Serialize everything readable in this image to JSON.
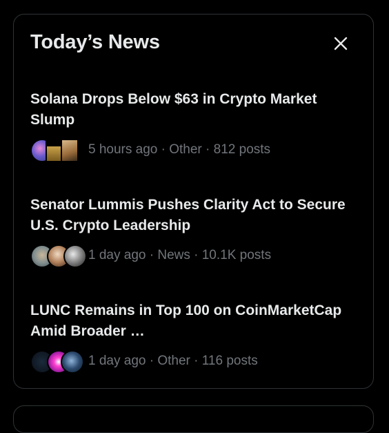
{
  "header": {
    "title": "Today’s News",
    "close_icon": "close-icon"
  },
  "items": [
    {
      "headline": "Solana Drops Below $63 in Crypto Market Slump",
      "meta": "5 hours ago · Other · 812 posts"
    },
    {
      "headline": "Senator Lummis Pushes Clarity Act to Secure U.S. Crypto Leadership",
      "meta": "1 day ago · News · 10.1K posts"
    },
    {
      "headline": "LUNC Remains in Top 100 on CoinMarketCap Amid Broader …",
      "meta": "1 day ago · Other · 116 posts"
    }
  ],
  "colors": {
    "background": "#000000",
    "border": "#2f3336",
    "text_primary": "#e7e9ea",
    "text_secondary": "#71767b"
  }
}
